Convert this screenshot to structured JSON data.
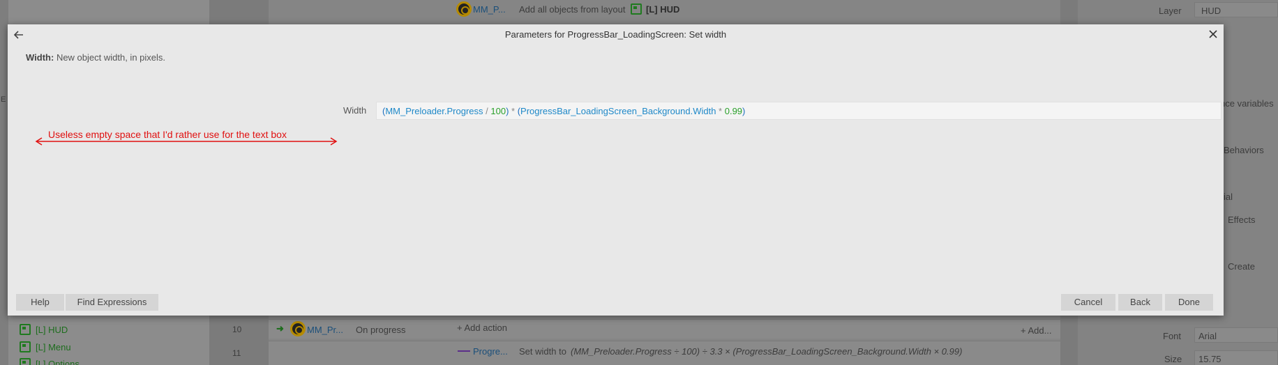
{
  "background": {
    "top_action": "Add all objects from layout",
    "top_action_target": "[L] HUD",
    "top_object_short": "MM_P...",
    "row_number_10": "10",
    "row_number_11": "11",
    "row10_object": "MM_Pr...",
    "row10_condition": "On progress",
    "row10_add_action": "+ Add action",
    "row10_add": "+ Add...",
    "row11_object": "Progre...",
    "row11_action": "Set width to",
    "row11_action_expr": "(MM_Preloader.Progress ÷ 100) ÷ 3.3 × (ProgressBar_LoadingScreen_Background.Width × 0.99)",
    "layouts": [
      "[L] HUD",
      "[L] Menu",
      "[L] Options"
    ],
    "left_edge_char": "E",
    "right_panel": {
      "layer_label": "Layer",
      "layer_value": "HUD",
      "instance_variables": "nce variables",
      "behaviors": "Behaviors",
      "font_partial": "ial",
      "effects": "Effects",
      "create": "Create",
      "font_label": "Font",
      "font_value": "Arial",
      "size_label": "Size",
      "size_value": "15.75"
    }
  },
  "dialog": {
    "title": "Parameters for ProgressBar_LoadingScreen: Set width",
    "description_label": "Width:",
    "description_text": "New object width, in pixels.",
    "param_label": "Width",
    "expression_tokens": {
      "open1": "(",
      "obj1": "MM_Preloader.Progress",
      "op1": " / ",
      "num1": "100",
      "close1": ")",
      "op2": " * ",
      "open2": "(",
      "obj2": "ProgressBar_LoadingScreen_Background.Width",
      "op3": " * ",
      "num2": "0.99",
      "close2": ")"
    },
    "annotation_text": "Useless empty space that I'd rather use for the text box",
    "annotation_color": "#e01010",
    "buttons": {
      "help": "Help",
      "find_expressions": "Find Expressions",
      "cancel": "Cancel",
      "back": "Back",
      "done": "Done"
    }
  }
}
